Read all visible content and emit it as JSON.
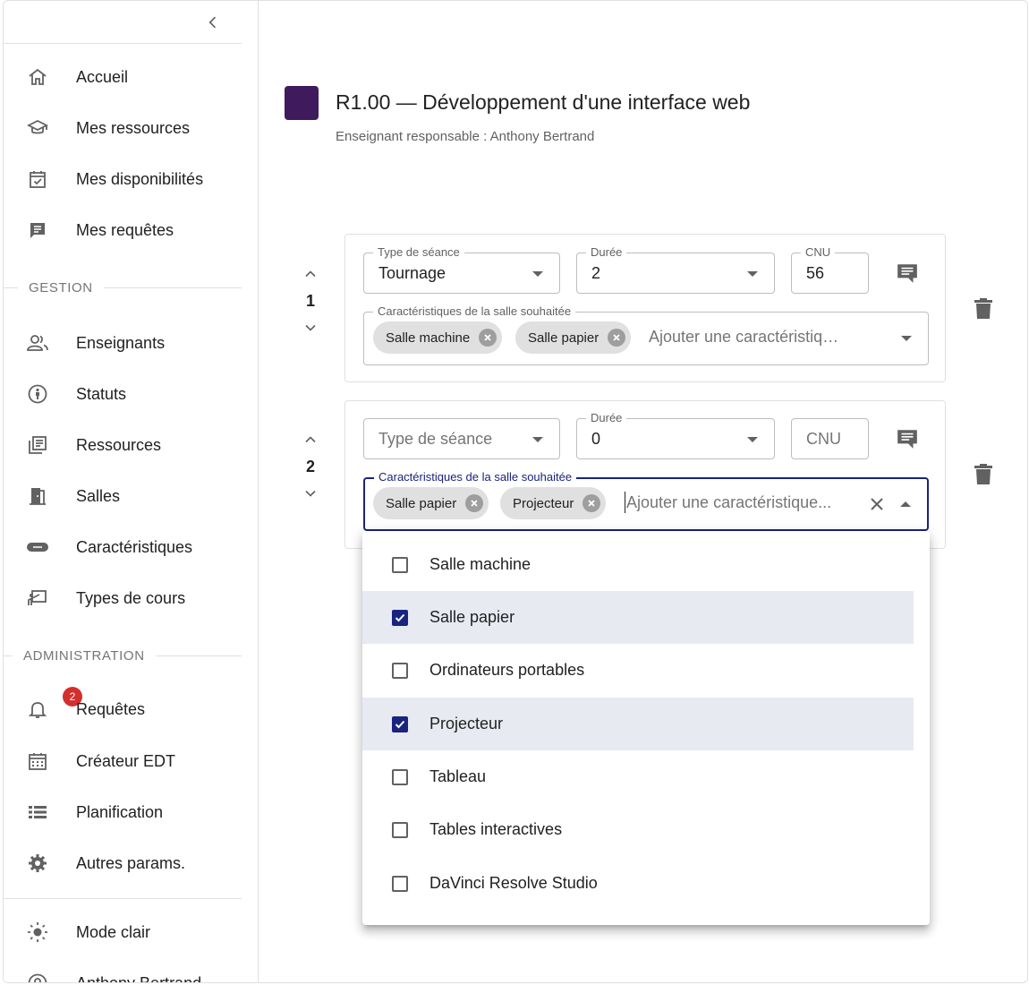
{
  "sidebar": {
    "nav": [
      {
        "label": "Accueil",
        "icon": "home-icon"
      },
      {
        "label": "Mes ressources",
        "icon": "school-icon"
      },
      {
        "label": "Mes disponibilités",
        "icon": "calendar-check-icon"
      },
      {
        "label": "Mes requêtes",
        "icon": "request-icon"
      }
    ],
    "gestion_title": "GESTION",
    "gestion": [
      {
        "label": "Enseignants",
        "icon": "people-icon"
      },
      {
        "label": "Statuts",
        "icon": "person-badge-icon"
      },
      {
        "label": "Ressources",
        "icon": "library-icon"
      },
      {
        "label": "Salles",
        "icon": "door-icon"
      },
      {
        "label": "Caractéristiques",
        "icon": "tag-icon"
      },
      {
        "label": "Types de cours",
        "icon": "presentation-icon"
      }
    ],
    "admin_title": "ADMINISTRATION",
    "admin": [
      {
        "label": "Requêtes",
        "icon": "bell-icon",
        "badge": "2"
      },
      {
        "label": "Créateur EDT",
        "icon": "calendar-grid-icon"
      },
      {
        "label": "Planification",
        "icon": "list-icon"
      },
      {
        "label": "Autres params.",
        "icon": "gear-icon"
      }
    ],
    "bottom": [
      {
        "label": "Mode clair",
        "icon": "sun-icon"
      },
      {
        "label": "Anthony Bertrand",
        "icon": "account-icon"
      }
    ]
  },
  "header": {
    "title": "R1.00 — Développement d'une interface web",
    "subtitle": "Enseignant responsable : Anthony Bertrand",
    "color": "#3f1a5c"
  },
  "sessions": [
    {
      "number": "1",
      "type_label": "Type de séance",
      "type_value": "Tournage",
      "duration_label": "Durée",
      "duration_value": "2",
      "cnu_label": "CNU",
      "cnu_value": "56",
      "features_label": "Caractéristiques de la salle souhaitée",
      "chips": [
        "Salle machine",
        "Salle papier"
      ],
      "features_placeholder": "Ajouter une caractéristiq…"
    },
    {
      "number": "2",
      "type_placeholder": "Type de séance",
      "duration_label": "Durée",
      "duration_value": "0",
      "cnu_placeholder": "CNU",
      "features_label": "Caractéristiques de la salle souhaitée",
      "chips": [
        "Salle papier",
        "Projecteur"
      ],
      "features_placeholder": "Ajouter une caractéristique..."
    }
  ],
  "dropdown": {
    "options": [
      {
        "label": "Salle machine",
        "checked": false
      },
      {
        "label": "Salle papier",
        "checked": true
      },
      {
        "label": "Ordinateurs portables",
        "checked": false
      },
      {
        "label": "Projecteur",
        "checked": true
      },
      {
        "label": "Tableau",
        "checked": false
      },
      {
        "label": "Tables interactives",
        "checked": false
      },
      {
        "label": "DaVinci Resolve Studio",
        "checked": false
      }
    ]
  },
  "colors": {
    "accent": "#1a237e",
    "badge": "#d32f2f",
    "chip": "#e0e0e0"
  }
}
